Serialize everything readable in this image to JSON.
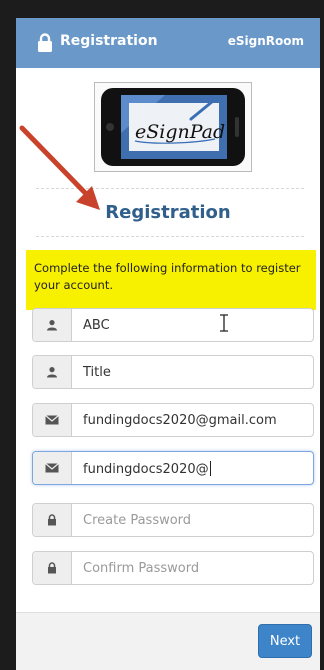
{
  "header": {
    "title": "Registration",
    "brand": "eSignRoom",
    "lock_icon": "lock-icon",
    "color": "#6a98c8"
  },
  "logo": {
    "text": "eSignPad"
  },
  "heading": "Registration",
  "notice": {
    "text": "Complete the following information to register your account.",
    "color": "#f7f100"
  },
  "fields": [
    {
      "icon": "user-icon",
      "value": "ABC",
      "placeholder": ""
    },
    {
      "icon": "user-icon",
      "value": "Title",
      "placeholder": ""
    },
    {
      "icon": "envelope-icon",
      "value": "fundingdocs2020@gmail.com",
      "placeholder": ""
    },
    {
      "icon": "envelope-icon",
      "value": "fundingdocs2020@",
      "placeholder": ""
    },
    {
      "icon": "lock-icon",
      "value": "",
      "placeholder": "Create Password"
    },
    {
      "icon": "lock-icon",
      "value": "",
      "placeholder": "Confirm Password"
    }
  ],
  "footer": {
    "next_label": "Next",
    "button_color": "#3d84c9"
  }
}
